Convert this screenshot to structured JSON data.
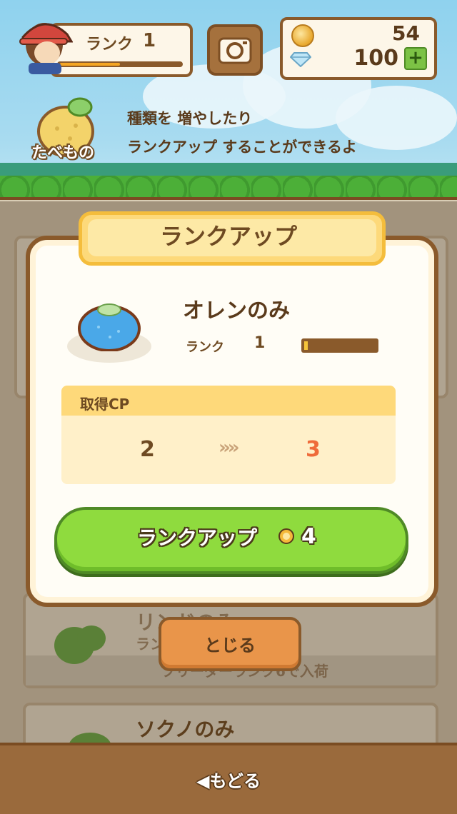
{
  "header": {
    "rank_label": "ランク",
    "rank_value": "1",
    "rank_progress": 0.5,
    "coins": "54",
    "gems": "100",
    "plus_label": "+",
    "category_label": "たべもの",
    "tip_line1": "種類を 増やしたり",
    "tip_line2": "ランクアップ することができるよ"
  },
  "background_list": {
    "item1_name": "リンドのみ",
    "item1_sub": "ラン",
    "item1_lock_text": "ブリーダーランク6で入荷",
    "item2_name": "ソクノのみ"
  },
  "modal": {
    "title": "ランクアップ",
    "item_name": "オレンのみ",
    "rank_label": "ランク",
    "rank_value": "1",
    "rank_progress": 0.05,
    "cp_label": "取得CP",
    "cp_from": "2",
    "cp_arrows": "»»",
    "cp_to": "3",
    "rankup_button_label": "ランクアップ",
    "rankup_cost": "4"
  },
  "close_label": "とじる",
  "back_label": "◀もどる",
  "colors": {
    "accent_green": "#8fdb3e",
    "brown": "#8a5a2b",
    "cp_to_color": "#ef6b3a"
  }
}
